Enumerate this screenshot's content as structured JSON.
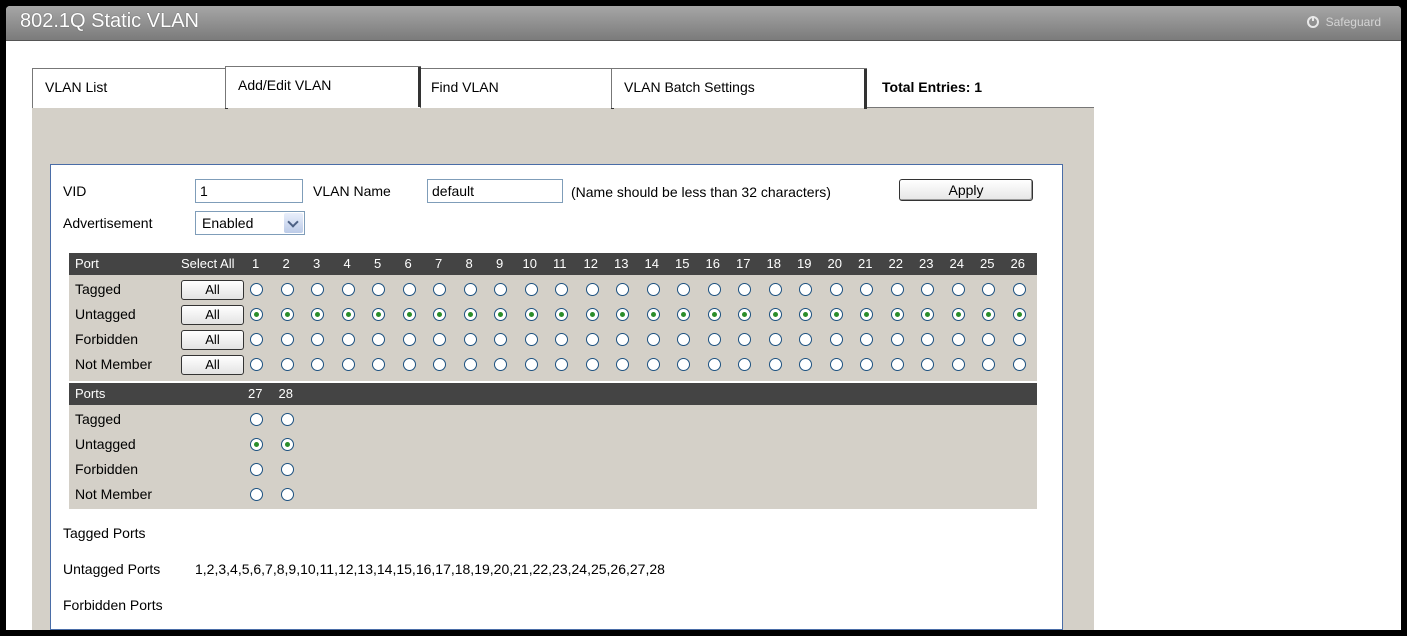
{
  "window": {
    "title": "802.1Q Static VLAN",
    "safeguard": "Safeguard"
  },
  "tabs": [
    {
      "label": "VLAN List",
      "active": false
    },
    {
      "label": "Add/Edit VLAN",
      "active": true
    },
    {
      "label": "Find VLAN",
      "active": false
    },
    {
      "label": "VLAN Batch Settings",
      "active": false
    }
  ],
  "total_entries": "Total Entries: 1",
  "form": {
    "vid_label": "VID",
    "vid_value": "1",
    "vlan_name_label": "VLAN Name",
    "vlan_name_value": "default",
    "name_hint": "(Name should be less than 32 characters)",
    "apply_label": "Apply",
    "advertisement_label": "Advertisement",
    "advertisement_value": "Enabled"
  },
  "ports_table": {
    "header_port": "Port",
    "header_select_all": "Select All",
    "all_label": "All",
    "ports1": [
      "1",
      "2",
      "3",
      "4",
      "5",
      "6",
      "7",
      "8",
      "9",
      "10",
      "11",
      "12",
      "13",
      "14",
      "15",
      "16",
      "17",
      "18",
      "19",
      "20",
      "21",
      "22",
      "23",
      "24",
      "25",
      "26"
    ],
    "header_ports2": "Ports",
    "ports2": [
      "27",
      "28"
    ],
    "rows": [
      {
        "label": "Tagged",
        "selected": false
      },
      {
        "label": "Untagged",
        "selected": true
      },
      {
        "label": "Forbidden",
        "selected": false
      },
      {
        "label": "Not Member",
        "selected": false
      }
    ]
  },
  "port_lists": {
    "tagged_label": "Tagged Ports",
    "tagged_value": "",
    "untagged_label": "Untagged Ports",
    "untagged_value": "1,2,3,4,5,6,7,8,9,10,11,12,13,14,15,16,17,18,19,20,21,22,23,24,25,26,27,28",
    "forbidden_label": "Forbidden Ports",
    "forbidden_value": ""
  },
  "colors": {
    "header_bg": "#444444",
    "panel_bg": "#d4d0c8",
    "radio_dot": "#2a8d2a",
    "form_border": "#4a6da7"
  },
  "icons": {
    "safeguard": "power-icon",
    "dropdown": "chevron-down-icon"
  }
}
